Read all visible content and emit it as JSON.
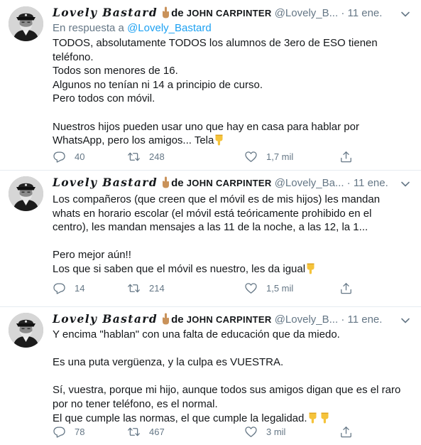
{
  "colors": {
    "text": "#14171a",
    "secondary": "#657786",
    "link": "#1da1f2",
    "divider": "#e6ecf0",
    "emoji_yellow": "#f5c33b",
    "emoji_skin": "#c9925a"
  },
  "tweets": [
    {
      "author": {
        "display_name": "Lovely Bastard",
        "de": "de",
        "caps": "JOHN CARPINTER",
        "handle": "@Lovely_B...",
        "separator": "·",
        "time": "11 ene."
      },
      "reply_label": "En respuesta a",
      "reply_to": "@Lovely_Bastard",
      "lines": [
        "TODOS, absolutamente TODOS los alumnos de 3ero de ESO tienen",
        "teléfono.",
        "Todos son menores de 16.",
        "Algunos no tenían ni 14 a principio de curso.",
        "Pero todos con móvil.",
        "",
        "Nuestros hijos pueden usar uno que hay en casa para hablar por",
        "WhatsApp, pero los amigos... Tela"
      ],
      "stats": {
        "replies": "40",
        "retweets": "248",
        "likes": "1,7 mil"
      }
    },
    {
      "author": {
        "display_name": "Lovely Bastard",
        "de": "de",
        "caps": "JOHN CARPINTER",
        "handle": "@Lovely_Ba...",
        "separator": "·",
        "time": "11 ene."
      },
      "lines": [
        "Los compañeros (que creen que el móvil es de mis hijos) les mandan",
        "whats en horario escolar (el móvil está teóricamente prohibido en el",
        "centro), les mandan mensajes a las 11 de la noche, a las 12, la 1...",
        "",
        "Pero mejor aún!!",
        "Los que si saben que el móvil es nuestro, les da igual"
      ],
      "stats": {
        "replies": "14",
        "retweets": "214",
        "likes": "1,5 mil"
      }
    },
    {
      "author": {
        "display_name": "Lovely Bastard",
        "de": "de",
        "caps": "JOHN CARPINTER",
        "handle": "@Lovely_B...",
        "separator": "·",
        "time": "11 ene."
      },
      "lines": [
        "Y encima \"hablan\" con una falta de educación que da miedo.",
        "",
        "Es una puta vergüenza, y la culpa es VUESTRA.",
        "",
        "Sí, vuestra, porque mi hijo, aunque todos sus amigos digan que es el raro",
        "por no tener teléfono, es el normal.",
        "El que cumple las normas, el que cumple la legalidad."
      ],
      "stats": {
        "replies": "78",
        "retweets": "467",
        "likes": "3 mil"
      }
    }
  ]
}
